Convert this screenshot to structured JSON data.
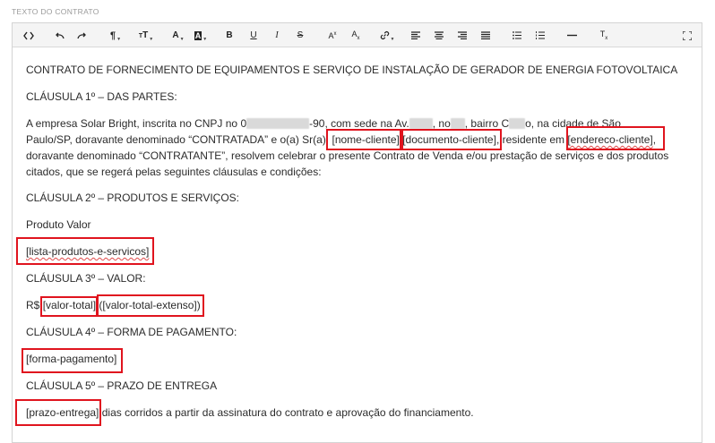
{
  "field_label": "TEXTO DO CONTRATO",
  "toolbar": {
    "buttons": [
      {
        "name": "source-code-button",
        "icon": "code-icon",
        "glyph": "<>"
      },
      {
        "name": "undo-button",
        "icon": "undo-icon",
        "glyph": "↶"
      },
      {
        "name": "redo-button",
        "icon": "redo-icon",
        "glyph": "↷"
      },
      {
        "name": "paragraph-format-button",
        "icon": "paragraph-icon",
        "glyph": "¶"
      },
      {
        "name": "font-size-button",
        "icon": "font-size-icon",
        "glyph": "тT"
      },
      {
        "name": "text-color-button",
        "icon": "text-color-icon",
        "glyph": "A"
      },
      {
        "name": "background-color-button",
        "icon": "background-color-icon",
        "glyph": "A"
      },
      {
        "name": "bold-button",
        "icon": "bold-icon",
        "glyph": "B"
      },
      {
        "name": "underline-button",
        "icon": "underline-icon",
        "glyph": "U"
      },
      {
        "name": "italic-button",
        "icon": "italic-icon",
        "glyph": "I"
      },
      {
        "name": "strikethrough-button",
        "icon": "strikethrough-icon",
        "glyph": "S"
      },
      {
        "name": "superscript-button",
        "icon": "superscript-icon",
        "glyph": "A"
      },
      {
        "name": "subscript-button",
        "icon": "subscript-icon",
        "glyph": "A"
      },
      {
        "name": "link-button",
        "icon": "link-icon",
        "glyph": "🔗"
      },
      {
        "name": "align-left-button",
        "icon": "align-left-icon",
        "glyph": "≡"
      },
      {
        "name": "align-center-button",
        "icon": "align-center-icon",
        "glyph": "≡"
      },
      {
        "name": "align-right-button",
        "icon": "align-right-icon",
        "glyph": "≡"
      },
      {
        "name": "align-justify-button",
        "icon": "align-justify-icon",
        "glyph": "≡"
      },
      {
        "name": "unordered-list-button",
        "icon": "unordered-list-icon",
        "glyph": "•"
      },
      {
        "name": "ordered-list-button",
        "icon": "ordered-list-icon",
        "glyph": "1."
      },
      {
        "name": "horizontal-line-button",
        "icon": "horizontal-line-icon",
        "glyph": "—"
      },
      {
        "name": "clear-format-button",
        "icon": "clear-format-icon",
        "glyph": "Tx"
      },
      {
        "name": "fullscreen-button",
        "icon": "fullscreen-icon",
        "glyph": "⤢"
      }
    ]
  },
  "document": {
    "title": "CONTRATO DE FORNECIMENTO DE EQUIPAMENTOS E SERVIÇO DE INSTALAÇÃO DE GERADOR DE ENERGIA FOTOVOLTAICA",
    "clause1_heading": "CLÁUSULA 1º – DAS PARTES:",
    "parties_line1_a": "A empresa Solar Bright, inscrita no CNPJ no 0",
    "parties_line1_b": "-90, com sede na Av.",
    "parties_line1_c": ", no",
    "parties_line1_d": ", bairro C",
    "parties_line1_e": "o, na cidade de São",
    "parties_line2_a": "Paulo/SP, doravante denominado “CONTRATADA” e o(a) Sr(a).",
    "placeholder_nome_cliente": "[nome-cliente]",
    "placeholder_documento_cliente": "[documento-cliente]",
    "parties_line2_b": "residente em",
    "placeholder_endereco_cliente": "[endereco-cliente]",
    "parties_line2_c": ",",
    "parties_line3": "doravante denominado “CONTRATANTE”, resolvem celebrar o presente Contrato de Venda e/ou prestação de serviços e dos produtos",
    "parties_line4": "citados, que se regerá pelas seguintes cláusulas e condições:",
    "clause2_heading": "CLÁUSULA 2º – PRODUTOS E SERVIÇOS:",
    "products_header": "Produto Valor",
    "placeholder_lista_produtos": "[lista-produtos-e-servicos]",
    "clause3_heading": "CLÁUSULA 3º – VALOR:",
    "currency": "R$",
    "placeholder_valor_total": "[valor-total]",
    "placeholder_valor_extenso": "([valor-total-extenso])",
    "clause4_heading": "CLÁUSULA 4º – FORMA DE PAGAMENTO:",
    "placeholder_forma_pagamento": "[forma-pagamento]",
    "clause5_heading": "CLÁUSULA 5º – PRAZO DE ENTREGA",
    "placeholder_prazo_entrega": "[prazo-entrega]",
    "delivery_text": "dias corridos a partir da assinatura do contrato e aprovação do financiamento."
  },
  "colors": {
    "highlight_border": "#e0141e",
    "toolbar_bg": "#f4f4f4",
    "spellcheck": "#e04a4a"
  }
}
